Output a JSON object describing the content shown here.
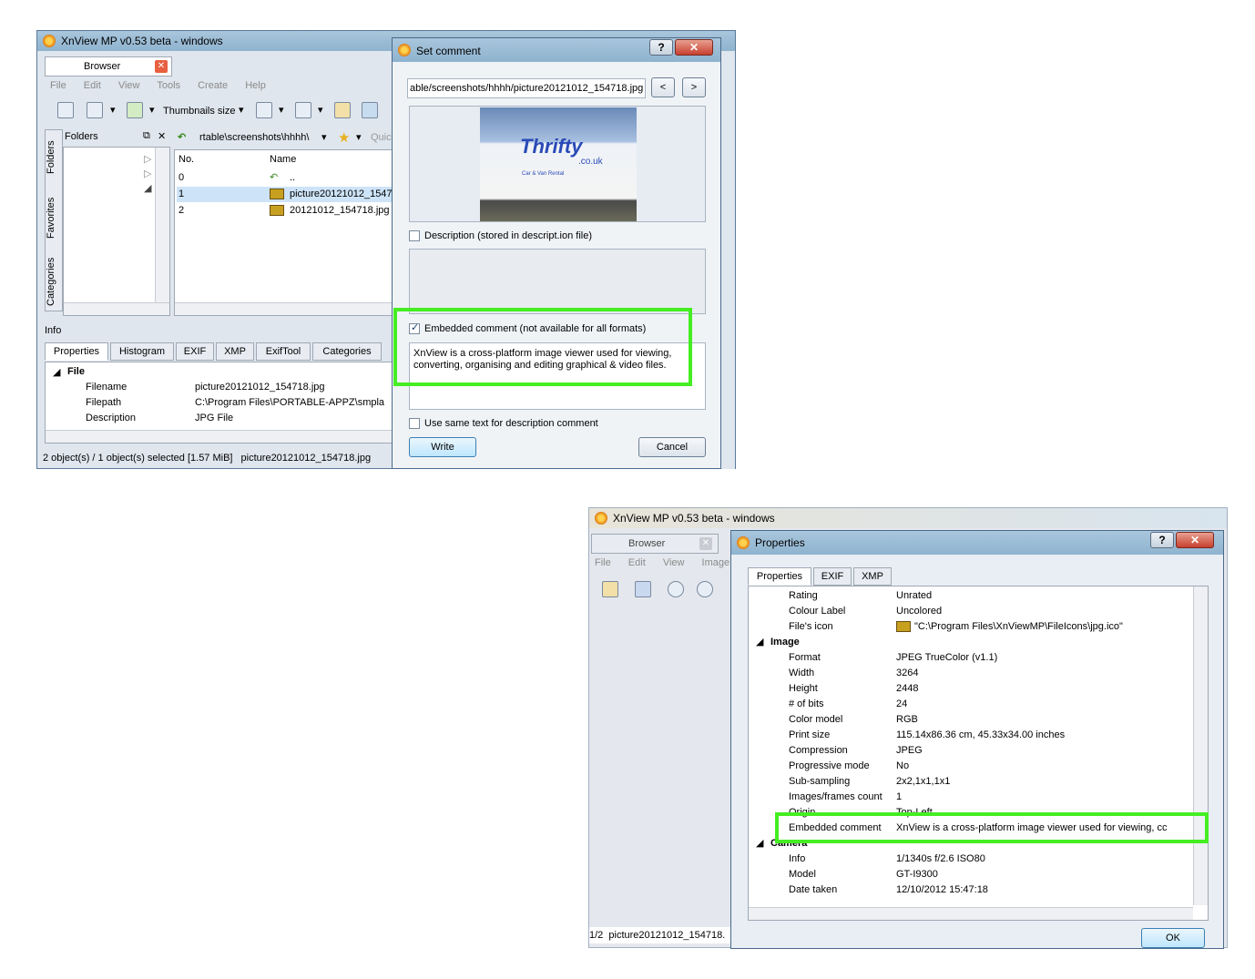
{
  "main_window": {
    "title": "XnView MP v0.53 beta - windows",
    "browser_tab": "Browser",
    "menu": [
      "File",
      "Edit",
      "View",
      "Tools",
      "Create",
      "Help"
    ],
    "toolbar_thumbnails": "Thumbnails size",
    "folders_label": "Folders",
    "vertical_tabs": [
      "Folders",
      "Favorites",
      "Categories"
    ],
    "path": "rtable\\screenshots\\hhhh\\",
    "quick_placeholder": "Quic",
    "columns": [
      "No.",
      "Name"
    ],
    "files": [
      {
        "no": "0",
        "name": ".."
      },
      {
        "no": "1",
        "name": "picture20121012_1547"
      },
      {
        "no": "2",
        "name": "20121012_154718.jpg"
      }
    ],
    "info_label": "Info",
    "info_tabs": [
      "Properties",
      "Histogram",
      "EXIF",
      "XMP",
      "ExifTool",
      "Categories"
    ],
    "file_section": "File",
    "props": [
      {
        "key": "Filename",
        "value": "picture20121012_154718.jpg"
      },
      {
        "key": "Filepath",
        "value": "C:\\Program Files\\PORTABLE-APPZ\\smpla"
      },
      {
        "key": "Description",
        "value": "JPG File"
      }
    ],
    "status_left": "2 object(s) / 1 object(s) selected [1.57 MiB]",
    "status_right": "picture20121012_154718.jpg"
  },
  "set_comment": {
    "title": "Set comment",
    "help": "?",
    "path": "able/screenshots/hhhh/picture20121012_154718.jpg",
    "prev": "<",
    "next": ">",
    "description_label": "Description (stored in descript.ion file)",
    "embedded_label": "Embedded comment (not available for all formats)",
    "embedded_text": "XnView is a cross-platform image viewer used for viewing, converting, organising and editing graphical & video files.",
    "same_text_label": "Use same text for description  comment",
    "write_button": "Write",
    "cancel_button": "Cancel",
    "preview_brand": "Thrifty",
    "preview_sub": ".co.uk",
    "preview_tag": "Car & Van Rental"
  },
  "second_window": {
    "title": "XnView MP v0.53 beta - windows",
    "browser_tab": "Browser",
    "menu": [
      "File",
      "Edit",
      "View",
      "Image"
    ],
    "status": "1/2  picture20121012_154718."
  },
  "properties_dialog": {
    "title": "Properties",
    "help": "?",
    "tabs": [
      "Properties",
      "EXIF",
      "XMP"
    ],
    "top_rows": [
      {
        "key": "Rating",
        "value": "Unrated"
      },
      {
        "key": "Colour Label",
        "value": "Uncolored"
      },
      {
        "key": "File's icon",
        "value": "\"C:\\Program Files\\XnViewMP\\FileIcons\\jpg.ico\""
      }
    ],
    "image_section": "Image",
    "image_rows": [
      {
        "key": "Format",
        "value": "JPEG TrueColor (v1.1)"
      },
      {
        "key": "Width",
        "value": "3264"
      },
      {
        "key": "Height",
        "value": "2448"
      },
      {
        "key": "# of bits",
        "value": "24"
      },
      {
        "key": "Color model",
        "value": "RGB"
      },
      {
        "key": "Print size",
        "value": "115.14x86.36 cm, 45.33x34.00 inches"
      },
      {
        "key": "Compression",
        "value": "JPEG"
      },
      {
        "key": "Progressive mode",
        "value": "No"
      },
      {
        "key": "Sub-sampling",
        "value": "2x2,1x1,1x1"
      },
      {
        "key": "Images/frames count",
        "value": "1"
      },
      {
        "key": "Origin",
        "value": "Top-Left"
      }
    ],
    "embedded_row": {
      "key": "Embedded comment",
      "value": "XnView is a cross-platform image viewer used for viewing, cc"
    },
    "camera_section": "Camera",
    "camera_rows": [
      {
        "key": "Info",
        "value": "1/1340s f/2.6 ISO80"
      },
      {
        "key": "Model",
        "value": "GT-I9300"
      },
      {
        "key": "Date taken",
        "value": "12/10/2012 15:47:18"
      }
    ],
    "ok_button": "OK"
  },
  "colors": {
    "highlight": "#44ee22",
    "titlebar": "#9dbdd6",
    "selection": "#cde3f7"
  }
}
